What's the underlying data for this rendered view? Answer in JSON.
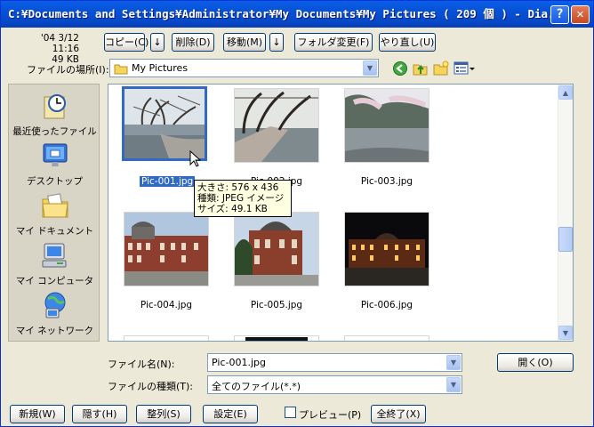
{
  "window": {
    "title": "C:¥Documents and Settings¥Administrator¥My Documents¥My Pictures ( 209 個 ) - Dia..."
  },
  "info": {
    "datetime": "'04 3/12 11:16",
    "size": "49 KB"
  },
  "toolbar": {
    "copy": "コピー(C)",
    "delete": "削除(D)",
    "move": "移動(M)",
    "change_folder": "フォルダ変更(F)",
    "redo": "やり直し(U)"
  },
  "location": {
    "label": "ファイルの場所(I):",
    "value": "My Pictures"
  },
  "places": [
    {
      "label": "最近使ったファイル",
      "icon": "recent-icon"
    },
    {
      "label": "デスクトップ",
      "icon": "desktop-icon"
    },
    {
      "label": "マイ ドキュメント",
      "icon": "my-documents-icon"
    },
    {
      "label": "マイ コンピュータ",
      "icon": "my-computer-icon"
    },
    {
      "label": "マイ ネットワーク",
      "icon": "my-network-icon"
    }
  ],
  "files": [
    {
      "name": "Pic-001.jpg",
      "selected": true
    },
    {
      "name": "Pic-002.jpg"
    },
    {
      "name": "Pic-003.jpg"
    },
    {
      "name": "Pic-004.jpg"
    },
    {
      "name": "Pic-005.jpg"
    },
    {
      "name": "Pic-006.jpg"
    }
  ],
  "tooltip": {
    "line1": "大きさ: 576 x 436",
    "line2": "種類: JPEG イメージ",
    "line3": "サイズ: 49.1 KB"
  },
  "filename": {
    "label": "ファイル名(N):",
    "value": "Pic-001.jpg"
  },
  "filetype": {
    "label": "ファイルの種類(T):",
    "value": "全てのファイル(*.*)"
  },
  "open_button": "開く(O)",
  "bottom": {
    "new": "新規(W)",
    "hide": "隠す(H)",
    "arrange": "整列(S)",
    "settings": "設定(E)",
    "preview": "プレビュー(P)",
    "exit_all": "全終了(X)"
  },
  "colors": {
    "title_bar": "#0A5FE6",
    "selection": "#316AC5",
    "face": "#ECE9D8"
  }
}
